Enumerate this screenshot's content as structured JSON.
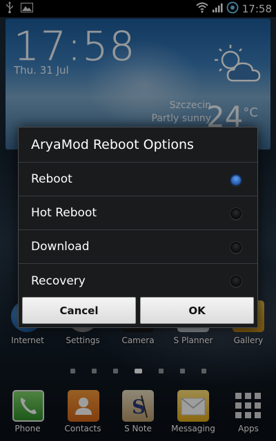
{
  "status_bar": {
    "time": "17:58",
    "icons": [
      "usb-icon",
      "image-notification-icon",
      "wifi-icon",
      "signal-icon",
      "sync-icon",
      "battery-icon"
    ]
  },
  "clock_widget": {
    "time": "17:58",
    "date": "Thu. 31 Jul",
    "city": "Szczecin",
    "condition": "Partly sunny",
    "temperature": "24",
    "temperature_unit": "°C",
    "weather_icon": "partly-sunny-icon"
  },
  "home_apps": [
    {
      "label": "Internet",
      "icon": "internet-icon"
    },
    {
      "label": "Settings",
      "icon": "settings-icon"
    },
    {
      "label": "Camera",
      "icon": "camera-icon"
    },
    {
      "label": "S Planner",
      "icon": "s-planner-icon"
    },
    {
      "label": "Gallery",
      "icon": "gallery-icon"
    }
  ],
  "page_indicator": {
    "count": 7,
    "active_index": 3
  },
  "dock": [
    {
      "label": "Phone",
      "icon": "phone-icon"
    },
    {
      "label": "Contacts",
      "icon": "contacts-icon"
    },
    {
      "label": "S Note",
      "icon": "s-note-icon"
    },
    {
      "label": "Messaging",
      "icon": "messaging-icon"
    },
    {
      "label": "Apps",
      "icon": "apps-grid-icon"
    }
  ],
  "dialog": {
    "title": "AryaMod Reboot Options",
    "options": [
      {
        "label": "Reboot",
        "selected": true
      },
      {
        "label": "Hot Reboot",
        "selected": false
      },
      {
        "label": "Download",
        "selected": false
      },
      {
        "label": "Recovery",
        "selected": false
      }
    ],
    "cancel_label": "Cancel",
    "ok_label": "OK"
  },
  "colors": {
    "dialog_background": "#1a1b1d",
    "radio_selected": "#3a78d6",
    "button_background": "#e8e8e8"
  }
}
